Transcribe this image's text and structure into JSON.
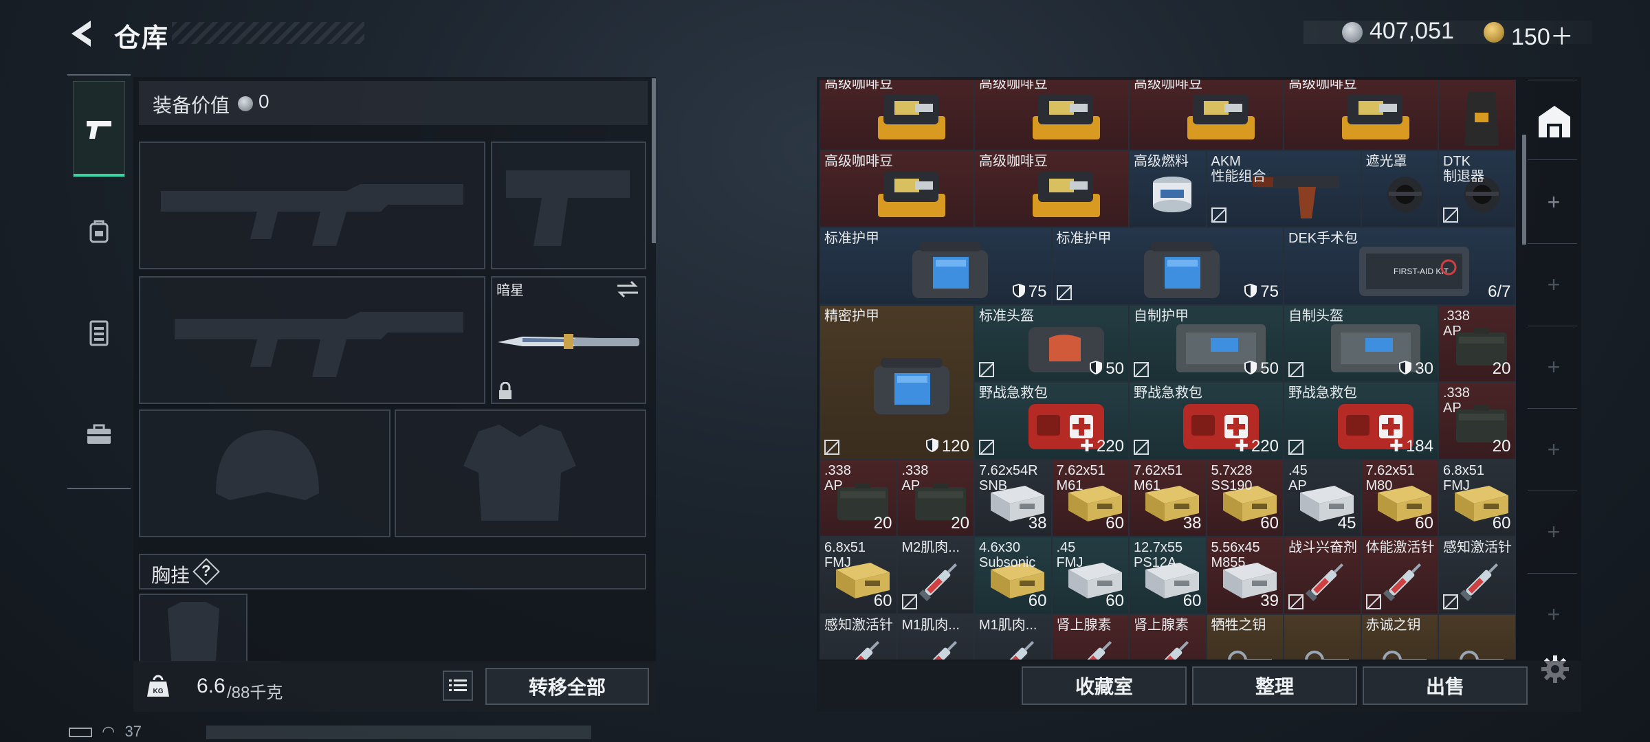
{
  "header": {
    "title": "仓库",
    "currency": {
      "money": "407,051",
      "coupons": "150＋"
    }
  },
  "loadout": {
    "value_label": "装备价值",
    "value": "0",
    "melee_name": "暗星",
    "rig_label": "胸挂",
    "rig_help": "?",
    "weight": "6.6",
    "weight_max": "/88千克",
    "transfer_all": "转移全部"
  },
  "stash_items": [
    {
      "name": "高级咖啡豆",
      "qty": "",
      "nodrop": false,
      "color": "red",
      "art": "coffee"
    },
    {
      "name": "高级咖啡豆",
      "qty": "",
      "nodrop": false,
      "color": "red",
      "art": "coffee"
    },
    {
      "name": "高级咖啡豆",
      "qty": "",
      "nodrop": false,
      "color": "red",
      "art": "coffee"
    },
    {
      "name": "高级咖啡豆",
      "qty": "",
      "nodrop": false,
      "color": "red",
      "art": "coffee"
    },
    {
      "name": "",
      "qty": "",
      "nodrop": false,
      "color": "red",
      "art": "bag"
    },
    {
      "name": "高级咖啡豆",
      "qty": "",
      "nodrop": false,
      "color": "red",
      "art": "coffee"
    },
    {
      "name": "高级咖啡豆",
      "qty": "",
      "nodrop": false,
      "color": "red",
      "art": "coffee"
    },
    {
      "name": "高级燃料",
      "qty": "",
      "nodrop": false,
      "color": "blue",
      "art": "can"
    },
    {
      "name": "AKM\n性能组合",
      "qty": "",
      "nodrop": true,
      "color": "blue",
      "art": "grip"
    },
    {
      "name": "遮光罩",
      "qty": "",
      "nodrop": false,
      "color": "blue",
      "art": "hood"
    },
    {
      "name": "DTK\n制退器",
      "qty": "",
      "nodrop": true,
      "color": "blue",
      "art": "hood"
    },
    {
      "name": "标准护甲",
      "qty": "75",
      "nodrop": false,
      "color": "blue",
      "art": "armor",
      "shield": true
    },
    {
      "name": "标准护甲",
      "qty": "75",
      "nodrop": true,
      "color": "blue",
      "art": "armor",
      "shield": true
    },
    {
      "name": "DEK手术包",
      "qty": "6/7",
      "nodrop": false,
      "color": "blue",
      "art": "kit"
    },
    {
      "name": "精密护甲",
      "qty": "120",
      "nodrop": true,
      "color": "gold",
      "art": "armor",
      "shield": true
    },
    {
      "name": "标准头盔",
      "qty": "50",
      "nodrop": true,
      "color": "teal",
      "art": "helmet",
      "shield": true
    },
    {
      "name": "自制护甲",
      "qty": "50",
      "nodrop": true,
      "color": "teal",
      "art": "plate",
      "shield": true
    },
    {
      "name": "自制头盔",
      "qty": "30",
      "nodrop": true,
      "color": "teal",
      "art": "plate",
      "shield": true
    },
    {
      "name": ".338\nAP",
      "qty": "20",
      "nodrop": false,
      "color": "red",
      "art": "ammo"
    },
    {
      "name": "野战急救包",
      "qty": "220",
      "nodrop": true,
      "color": "teal",
      "art": "medkit",
      "plus": true
    },
    {
      "name": "野战急救包",
      "qty": "220",
      "nodrop": true,
      "color": "teal",
      "art": "medkit",
      "plus": true
    },
    {
      "name": "野战急救包",
      "qty": "184",
      "nodrop": true,
      "color": "teal",
      "art": "medkit",
      "plus": true
    },
    {
      "name": ".338\nAP",
      "qty": "20",
      "nodrop": false,
      "color": "red",
      "art": "ammo"
    },
    {
      "name": ".338\nAP",
      "qty": "20",
      "nodrop": false,
      "color": "red",
      "art": "ammo"
    },
    {
      "name": ".338\nAP",
      "qty": "20",
      "nodrop": false,
      "color": "red",
      "art": "ammo"
    },
    {
      "name": "7.62x54R\nSNB",
      "qty": "38",
      "nodrop": false,
      "color": "dark",
      "art": "box"
    },
    {
      "name": "7.62x51\nM61",
      "qty": "60",
      "nodrop": false,
      "color": "red",
      "art": "gbox"
    },
    {
      "name": "7.62x51\nM61",
      "qty": "38",
      "nodrop": false,
      "color": "red",
      "art": "gbox"
    },
    {
      "name": "5.7x28\nSS190",
      "qty": "60",
      "nodrop": false,
      "color": "red",
      "art": "gbox"
    },
    {
      "name": ".45\nAP",
      "qty": "45",
      "nodrop": false,
      "color": "dark",
      "art": "box"
    },
    {
      "name": "7.62x51\nM80",
      "qty": "60",
      "nodrop": false,
      "color": "red",
      "art": "gbox"
    },
    {
      "name": "6.8x51\nFMJ",
      "qty": "60",
      "nodrop": false,
      "color": "dark",
      "art": "gbox"
    },
    {
      "name": "6.8x51\nFMJ",
      "qty": "60",
      "nodrop": false,
      "color": "dark",
      "art": "gbox"
    },
    {
      "name": "M2肌肉...",
      "qty": "",
      "nodrop": true,
      "color": "dark",
      "art": "syringe"
    },
    {
      "name": "4.6x30\nSubsonic",
      "qty": "60",
      "nodrop": false,
      "color": "teal",
      "art": "gbox"
    },
    {
      "name": ".45\nFMJ",
      "qty": "60",
      "nodrop": false,
      "color": "teal",
      "art": "box"
    },
    {
      "name": "12.7x55\nPS12A",
      "qty": "60",
      "nodrop": false,
      "color": "teal",
      "art": "box"
    },
    {
      "name": "5.56x45\nM855",
      "qty": "39",
      "nodrop": false,
      "color": "red",
      "art": "box"
    },
    {
      "name": "战斗兴奋剂",
      "qty": "",
      "nodrop": true,
      "color": "red",
      "art": "syringe"
    },
    {
      "name": "体能激活针",
      "qty": "",
      "nodrop": true,
      "color": "red",
      "art": "syringe"
    },
    {
      "name": "感知激活针",
      "qty": "",
      "nodrop": true,
      "color": "dark",
      "art": "syringe"
    },
    {
      "name": "感知激活针",
      "qty": "",
      "nodrop": false,
      "color": "dark",
      "art": "syringe"
    },
    {
      "name": "M1肌肉...",
      "qty": "",
      "nodrop": false,
      "color": "dark",
      "art": "syringe"
    },
    {
      "name": "M1肌肉...",
      "qty": "",
      "nodrop": false,
      "color": "dark",
      "art": "syringe"
    },
    {
      "name": "肾上腺素",
      "qty": "",
      "nodrop": false,
      "color": "red",
      "art": "syringe"
    },
    {
      "name": "肾上腺素",
      "qty": "",
      "nodrop": false,
      "color": "red",
      "art": "syringe"
    },
    {
      "name": "牺牲之钥",
      "qty": "",
      "nodrop": false,
      "color": "gold",
      "art": "key"
    },
    {
      "name": "",
      "qty": "",
      "nodrop": false,
      "color": "gold",
      "art": "key"
    },
    {
      "name": "赤诚之钥",
      "qty": "",
      "nodrop": false,
      "color": "gold",
      "art": "key"
    },
    {
      "name": "",
      "qty": "",
      "nodrop": false,
      "color": "gold",
      "art": "key"
    }
  ],
  "actions": {
    "collection": "收藏室",
    "sort": "整理",
    "sell": "出售"
  },
  "status_bar": {
    "text": "37"
  },
  "colors": {
    "accent": "#3fd1a0",
    "rarity_red": "#4a2426",
    "rarity_blue": "#25364a",
    "rarity_gold": "#4a3a26"
  }
}
